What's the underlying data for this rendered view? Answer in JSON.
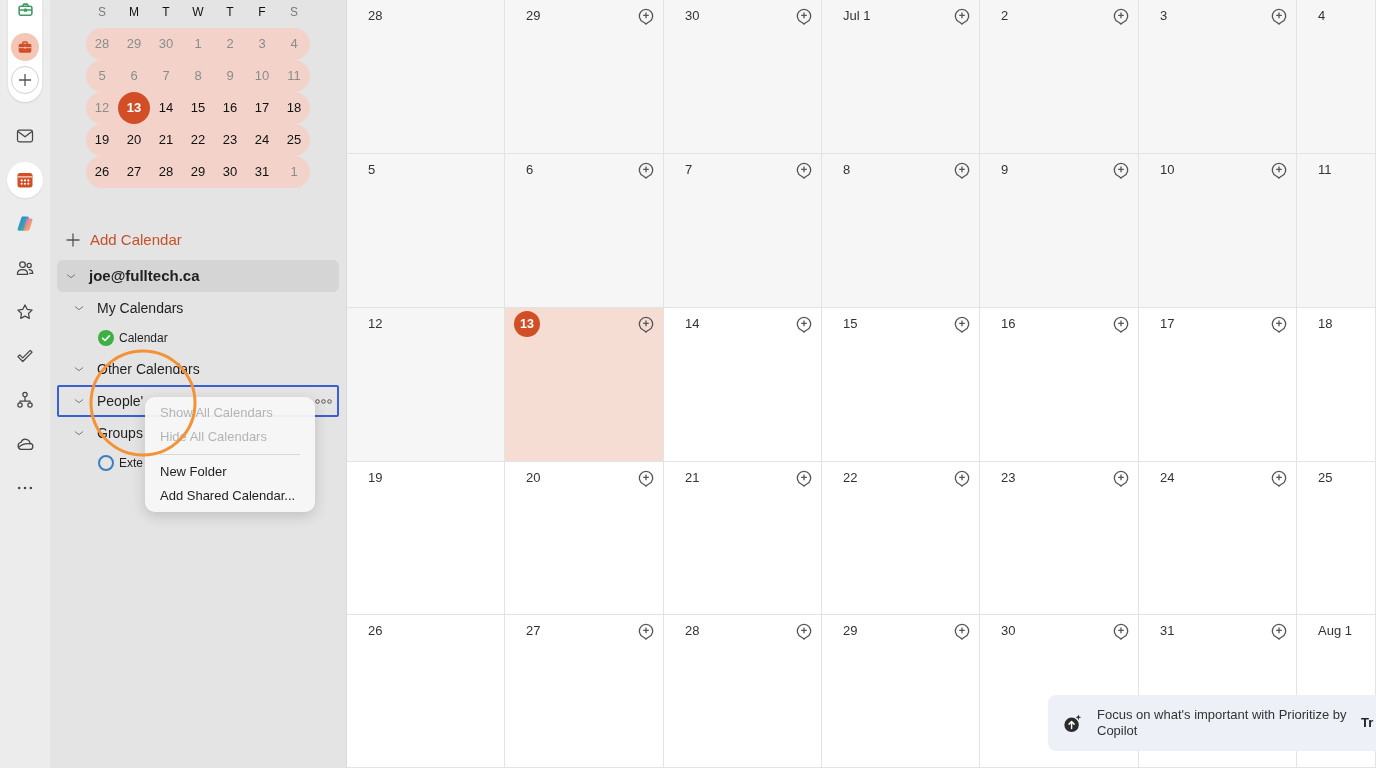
{
  "app_rail": {
    "accounts": [
      {
        "selected": false,
        "color": "#3d9a62"
      },
      {
        "selected": true,
        "color": "#d24e26"
      }
    ],
    "apps": [
      {
        "kind": "mail",
        "selected": false
      },
      {
        "kind": "calendar",
        "selected": true
      },
      {
        "kind": "copilot",
        "selected": false
      },
      {
        "kind": "people",
        "selected": false
      },
      {
        "kind": "favorites",
        "selected": false
      },
      {
        "kind": "todo",
        "selected": false
      },
      {
        "kind": "org",
        "selected": false
      },
      {
        "kind": "cloud",
        "selected": false
      },
      {
        "kind": "more",
        "selected": false
      }
    ]
  },
  "sidebar": {
    "mini_calendar": {
      "weekdays": [
        {
          "label": "S",
          "weekend": true
        },
        {
          "label": "M",
          "weekend": false
        },
        {
          "label": "T",
          "weekend": false
        },
        {
          "label": "W",
          "weekend": false
        },
        {
          "label": "T",
          "weekend": false
        },
        {
          "label": "F",
          "weekend": false
        },
        {
          "label": "S",
          "weekend": true
        }
      ],
      "weeks": [
        {
          "days": [
            {
              "label": "28",
              "muted": true,
              "selected": false
            },
            {
              "label": "29",
              "muted": true,
              "selected": false
            },
            {
              "label": "30",
              "muted": true,
              "selected": false
            },
            {
              "label": "1",
              "muted": true,
              "selected": false
            },
            {
              "label": "2",
              "muted": true,
              "selected": false
            },
            {
              "label": "3",
              "muted": true,
              "selected": false
            },
            {
              "label": "4",
              "muted": true,
              "selected": false
            }
          ]
        },
        {
          "days": [
            {
              "label": "5",
              "muted": true,
              "selected": false
            },
            {
              "label": "6",
              "muted": true,
              "selected": false
            },
            {
              "label": "7",
              "muted": true,
              "selected": false
            },
            {
              "label": "8",
              "muted": true,
              "selected": false
            },
            {
              "label": "9",
              "muted": true,
              "selected": false
            },
            {
              "label": "10",
              "muted": true,
              "selected": false
            },
            {
              "label": "11",
              "muted": true,
              "selected": false
            }
          ]
        },
        {
          "days": [
            {
              "label": "12",
              "muted": true,
              "selected": false
            },
            {
              "label": "13",
              "muted": false,
              "selected": true
            },
            {
              "label": "14",
              "muted": false,
              "selected": false
            },
            {
              "label": "15",
              "muted": false,
              "selected": false
            },
            {
              "label": "16",
              "muted": false,
              "selected": false
            },
            {
              "label": "17",
              "muted": false,
              "selected": false
            },
            {
              "label": "18",
              "muted": false,
              "selected": false
            }
          ]
        },
        {
          "days": [
            {
              "label": "19",
              "muted": false,
              "selected": false
            },
            {
              "label": "20",
              "muted": false,
              "selected": false
            },
            {
              "label": "21",
              "muted": false,
              "selected": false
            },
            {
              "label": "22",
              "muted": false,
              "selected": false
            },
            {
              "label": "23",
              "muted": false,
              "selected": false
            },
            {
              "label": "24",
              "muted": false,
              "selected": false
            },
            {
              "label": "25",
              "muted": false,
              "selected": false
            }
          ]
        },
        {
          "days": [
            {
              "label": "26",
              "muted": false,
              "selected": false
            },
            {
              "label": "27",
              "muted": false,
              "selected": false
            },
            {
              "label": "28",
              "muted": false,
              "selected": false
            },
            {
              "label": "29",
              "muted": false,
              "selected": false
            },
            {
              "label": "30",
              "muted": false,
              "selected": false
            },
            {
              "label": "31",
              "muted": false,
              "selected": false
            },
            {
              "label": "1",
              "muted": true,
              "selected": false
            }
          ]
        }
      ]
    },
    "add_calendar": "Add Calendar",
    "account": {
      "label": "joe@fulltech.ca",
      "expanded": true,
      "selected": true,
      "children": [
        {
          "label": "My Calendars",
          "expanded": true,
          "focused": false,
          "children": [
            {
              "label": "Calendar",
              "checked": true,
              "color": "#3cb043"
            }
          ]
        },
        {
          "label": "Other Calendars",
          "expanded": true,
          "focused": false
        },
        {
          "label": "People'",
          "expanded": true,
          "focused": true
        },
        {
          "label": "Groups",
          "expanded": true,
          "focused": false,
          "children": [
            {
              "label": "Exte",
              "checked": false,
              "color": "#3b7fc0"
            }
          ]
        }
      ]
    }
  },
  "context_menu": {
    "items": [
      {
        "kind": "item",
        "label": "Show All Calendars",
        "disabled": true
      },
      {
        "kind": "item",
        "label": "Hide All Calendars",
        "disabled": true
      },
      {
        "kind": "separator"
      },
      {
        "kind": "item",
        "label": "New Folder",
        "disabled": false
      },
      {
        "kind": "item",
        "label": "Add Shared Calendar...",
        "disabled": false
      }
    ]
  },
  "month_view": {
    "weeks": [
      {
        "days": [
          {
            "label": "28",
            "kind": "past",
            "add_icon": false
          },
          {
            "label": "29",
            "kind": "past",
            "add_icon": true
          },
          {
            "label": "30",
            "kind": "past",
            "add_icon": true
          },
          {
            "label": "Jul 1",
            "kind": "past",
            "add_icon": true
          },
          {
            "label": "2",
            "kind": "past",
            "add_icon": true
          },
          {
            "label": "3",
            "kind": "past",
            "add_icon": true
          },
          {
            "label": "4",
            "kind": "past",
            "add_icon": false
          }
        ]
      },
      {
        "days": [
          {
            "label": "5",
            "kind": "past",
            "add_icon": false
          },
          {
            "label": "6",
            "kind": "past",
            "add_icon": true
          },
          {
            "label": "7",
            "kind": "past",
            "add_icon": true
          },
          {
            "label": "8",
            "kind": "past",
            "add_icon": true
          },
          {
            "label": "9",
            "kind": "past",
            "add_icon": true
          },
          {
            "label": "10",
            "kind": "past",
            "add_icon": true
          },
          {
            "label": "11",
            "kind": "past",
            "add_icon": false
          }
        ]
      },
      {
        "days": [
          {
            "label": "12",
            "kind": "past",
            "add_icon": false
          },
          {
            "label": "13",
            "kind": "today",
            "add_icon": true
          },
          {
            "label": "14",
            "kind": "future",
            "add_icon": true
          },
          {
            "label": "15",
            "kind": "future",
            "add_icon": true
          },
          {
            "label": "16",
            "kind": "future",
            "add_icon": true
          },
          {
            "label": "17",
            "kind": "future",
            "add_icon": true
          },
          {
            "label": "18",
            "kind": "future",
            "add_icon": false
          }
        ]
      },
      {
        "days": [
          {
            "label": "19",
            "kind": "future",
            "add_icon": false
          },
          {
            "label": "20",
            "kind": "future",
            "add_icon": true
          },
          {
            "label": "21",
            "kind": "future",
            "add_icon": true
          },
          {
            "label": "22",
            "kind": "future",
            "add_icon": true
          },
          {
            "label": "23",
            "kind": "future",
            "add_icon": true
          },
          {
            "label": "24",
            "kind": "future",
            "add_icon": true
          },
          {
            "label": "25",
            "kind": "future",
            "add_icon": false
          }
        ]
      },
      {
        "days": [
          {
            "label": "26",
            "kind": "future",
            "add_icon": false
          },
          {
            "label": "27",
            "kind": "future",
            "add_icon": true
          },
          {
            "label": "28",
            "kind": "future",
            "add_icon": true
          },
          {
            "label": "29",
            "kind": "future",
            "add_icon": true
          },
          {
            "label": "30",
            "kind": "future",
            "add_icon": true
          },
          {
            "label": "31",
            "kind": "future",
            "add_icon": true
          },
          {
            "label": "Aug 1",
            "kind": "future",
            "add_icon": false
          }
        ]
      }
    ]
  },
  "notification": {
    "message": "Focus on what's important with Prioritize by Copilot",
    "action": "Tr"
  }
}
